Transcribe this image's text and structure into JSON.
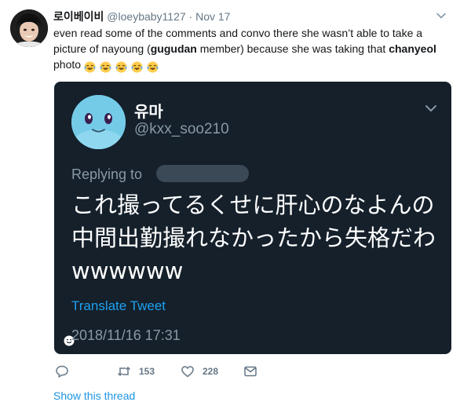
{
  "tweet": {
    "display_name": "로이베이비",
    "handle": "@loeybaby1127",
    "separator": "·",
    "date": "Nov 17",
    "text_parts": [
      "even read some of the comments and convo there she wasn’t able to take a picture of nayoung (",
      "gugudan",
      " member) because she was taking that ",
      "chanyeol",
      " photo"
    ],
    "emoji": [
      "face-with-tears-of-joy",
      "face-with-tears-of-joy",
      "face-with-tears-of-joy",
      "face-with-tears-of-joy",
      "face-with-tears-of-joy"
    ]
  },
  "screenshot": {
    "name": "유마",
    "handle": "@kxx_soo210",
    "replying_to": "Replying to",
    "text": "これ撮ってるくせに肝心のなよんの中間出勤撮れなかったから失格だわwwwwww",
    "translate_label": "Translate Tweet",
    "timestamp": "2018/11/16 17:31"
  },
  "actions": {
    "reply_count": "",
    "retweet_count": "153",
    "like_count": "228"
  },
  "show_thread": "Show this thread",
  "colors": {
    "link": "#1b95e0",
    "muted": "#657786",
    "dark_bg": "#15202b"
  }
}
